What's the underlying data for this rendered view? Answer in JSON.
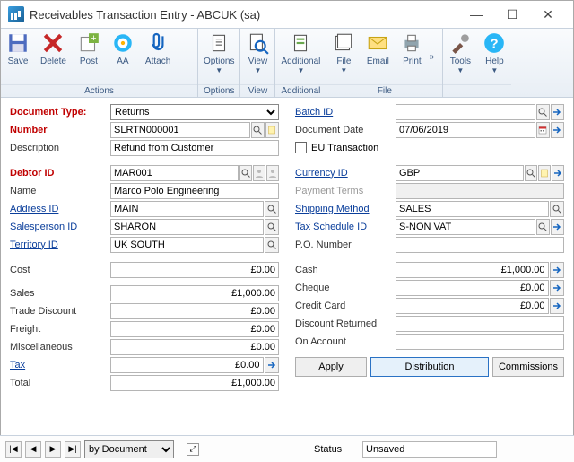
{
  "window": {
    "title": "Receivables Transaction Entry  -  ABCUK (sa)"
  },
  "ribbon": {
    "save": "Save",
    "delete": "Delete",
    "post": "Post",
    "aa": "AA",
    "attach": "Attach",
    "options": "Options",
    "view": "View",
    "additional": "Additional",
    "file": "File",
    "email": "Email",
    "print": "Print",
    "tools": "Tools",
    "help": "Help",
    "g_actions": "Actions",
    "g_options": "Options",
    "g_view": "View",
    "g_additional": "Additional",
    "g_file": "File"
  },
  "left1": {
    "doc_type_lbl": "Document Type:",
    "doc_type_val": "Returns",
    "number_lbl": "Number",
    "number_val": "SLRTN000001",
    "desc_lbl": "Description",
    "desc_val": "Refund from Customer"
  },
  "right1": {
    "batch_lbl": "Batch ID",
    "batch_val": "",
    "docdate_lbl": "Document Date",
    "docdate_val": "07/06/2019",
    "eutrans_lbl": "EU Transaction"
  },
  "left2": {
    "debtor_lbl": "Debtor ID",
    "debtor_val": "MAR001",
    "name_lbl": "Name",
    "name_val": "Marco Polo Engineering",
    "addr_lbl": "Address ID",
    "addr_val": "MAIN",
    "sp_lbl": "Salesperson ID",
    "sp_val": "SHARON",
    "terr_lbl": "Territory ID",
    "terr_val": "UK SOUTH"
  },
  "right2": {
    "cur_lbl": "Currency ID",
    "cur_val": "GBP",
    "pt_lbl": "Payment Terms",
    "pt_val": "",
    "ship_lbl": "Shipping Method",
    "ship_val": "SALES",
    "tax_lbl": "Tax Schedule ID",
    "tax_val": "S-NON VAT",
    "po_lbl": "P.O. Number",
    "po_val": ""
  },
  "left3": {
    "cost_lbl": "Cost",
    "cost_val": "£0.00",
    "sales_lbl": "Sales",
    "sales_val": "£1,000.00",
    "td_lbl": "Trade Discount",
    "td_val": "£0.00",
    "freight_lbl": "Freight",
    "freight_val": "£0.00",
    "misc_lbl": "Miscellaneous",
    "misc_val": "£0.00",
    "tax_lbl": "Tax",
    "tax_val": "£0.00",
    "total_lbl": "Total",
    "total_val": "£1,000.00"
  },
  "right3": {
    "cash_lbl": "Cash",
    "cash_val": "£1,000.00",
    "cheque_lbl": "Cheque",
    "cheque_val": "£0.00",
    "cc_lbl": "Credit Card",
    "cc_val": "£0.00",
    "dr_lbl": "Discount Returned",
    "dr_val": "",
    "oa_lbl": "On Account",
    "oa_val": ""
  },
  "buttons": {
    "apply": "Apply",
    "dist": "Distribution",
    "comm": "Commissions"
  },
  "footer": {
    "by": "by Document",
    "status_lbl": "Status",
    "status_val": "Unsaved"
  }
}
